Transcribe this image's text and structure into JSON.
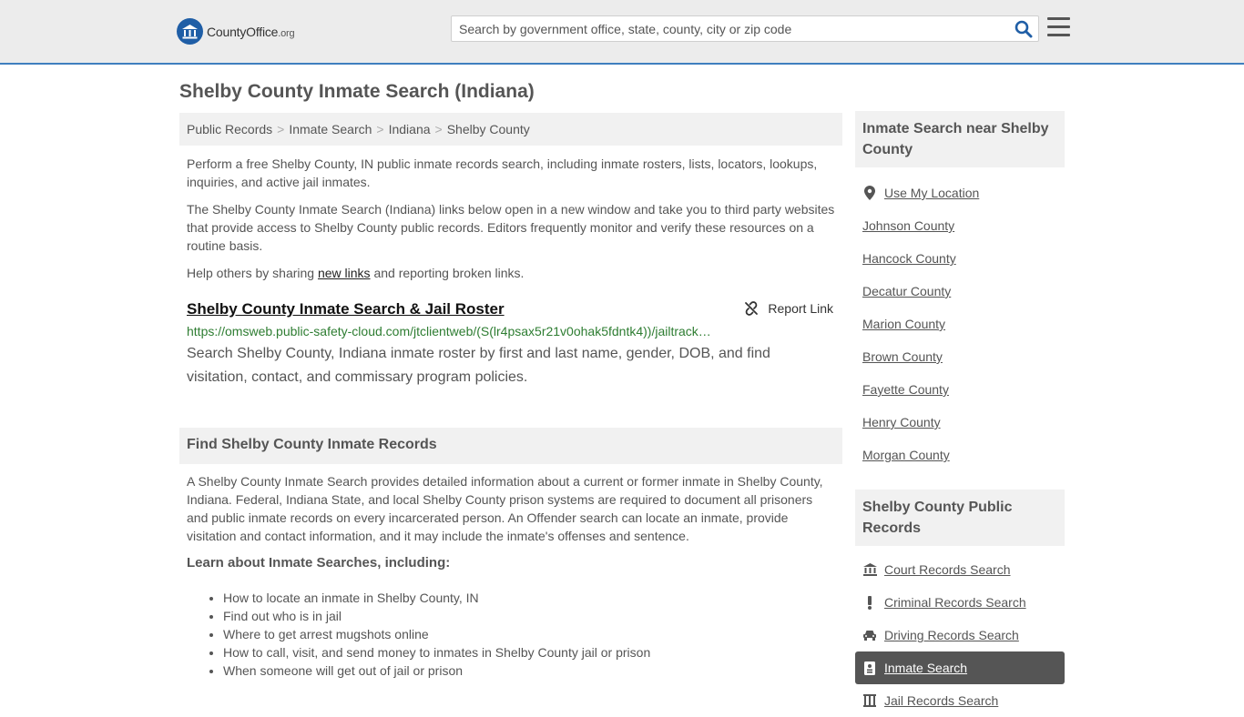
{
  "header": {
    "logo_name": "CountyOffice",
    "logo_tld": ".org",
    "search_placeholder": "Search by government office, state, county, city or zip code"
  },
  "page": {
    "title": "Shelby County Inmate Search (Indiana)"
  },
  "breadcrumb": [
    "Public Records",
    "Inmate Search",
    "Indiana",
    "Shelby County"
  ],
  "intro": {
    "p1": "Perform a free Shelby County, IN public inmate records search, including inmate rosters, lists, locators, lookups, inquiries, and active jail inmates.",
    "p2": "The Shelby County Inmate Search (Indiana) links below open in a new window and take you to third party websites that provide access to Shelby County public records. Editors frequently monitor and verify these resources on a routine basis.",
    "p3_before": "Help others by sharing ",
    "p3_link": "new links",
    "p3_after": " and reporting broken links."
  },
  "result": {
    "title": "Shelby County Inmate Search & Jail Roster",
    "report_label": "Report Link",
    "url": "https://omsweb.public-safety-cloud.com/jtclientweb/(S(lr4psax5r21v0ohak5fdntk4))/jailtrack…",
    "description": "Search Shelby County, Indiana inmate roster by first and last name, gender, DOB, and find visitation, contact, and commissary program policies."
  },
  "records_section": {
    "heading": "Find Shelby County Inmate Records",
    "body": "A Shelby County Inmate Search provides detailed information about a current or former inmate in Shelby County, Indiana. Federal, Indiana State, and local Shelby County prison systems are required to document all prisoners and public inmate records on every incarcerated person. An Offender search can locate an inmate, provide visitation and contact information, and it may include the inmate's offenses and sentence.",
    "learn_heading": "Learn about Inmate Searches, including:",
    "learn_items": [
      "How to locate an inmate in Shelby County, IN",
      "Find out who is in jail",
      "Where to get arrest mugshots online",
      "How to call, visit, and send money to inmates in Shelby County jail or prison",
      "When someone will get out of jail or prison"
    ]
  },
  "sidebar": {
    "near_heading": "Inmate Search near Shelby County",
    "near_items": [
      {
        "label": "Use My Location",
        "icon": "map-marker-icon"
      },
      {
        "label": "Johnson County"
      },
      {
        "label": "Hancock County"
      },
      {
        "label": "Decatur County"
      },
      {
        "label": "Marion County"
      },
      {
        "label": "Brown County"
      },
      {
        "label": "Fayette County"
      },
      {
        "label": "Henry County"
      },
      {
        "label": "Morgan County"
      }
    ],
    "records_heading": "Shelby County Public Records",
    "records_items": [
      {
        "label": "Court Records Search",
        "icon": "courthouse-icon"
      },
      {
        "label": "Criminal Records Search",
        "icon": "exclamation-icon"
      },
      {
        "label": "Driving Records Search",
        "icon": "car-icon"
      },
      {
        "label": "Inmate Search",
        "icon": "id-card-icon",
        "active": true
      },
      {
        "label": "Jail Records Search",
        "icon": "jail-icon"
      }
    ]
  },
  "colors": {
    "header_bg": "#ececec",
    "header_border": "#3f7fbf",
    "logo_blue": "#1f5ea6",
    "url_green": "#2e7d32",
    "active_bg": "#555555"
  }
}
